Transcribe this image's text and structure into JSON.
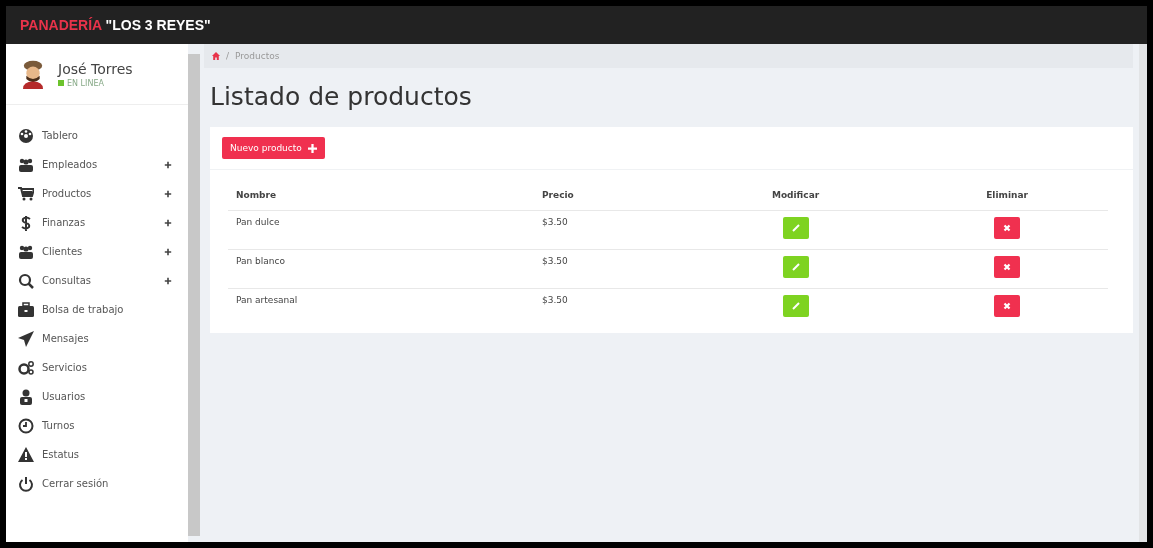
{
  "topbar": {
    "brand_main": "PANADERÍA",
    "brand_name": "\"LOS 3 REYES\""
  },
  "sidebar": {
    "user": {
      "name": "José Torres",
      "status": "EN LINEA",
      "online": true
    },
    "items": [
      {
        "label": "Tablero",
        "expandable": false
      },
      {
        "label": "Empleados",
        "expandable": true
      },
      {
        "label": "Productos",
        "expandable": true
      },
      {
        "label": "Finanzas",
        "expandable": true
      },
      {
        "label": "Clientes",
        "expandable": true
      },
      {
        "label": "Consultas",
        "expandable": true
      },
      {
        "label": "Bolsa de trabajo",
        "expandable": false
      },
      {
        "label": "Mensajes",
        "expandable": false
      },
      {
        "label": "Servicios",
        "expandable": false
      },
      {
        "label": "Usuarios",
        "expandable": false
      },
      {
        "label": "Turnos",
        "expandable": false
      },
      {
        "label": "Estatus",
        "expandable": false
      },
      {
        "label": "Cerrar sesión",
        "expandable": false
      }
    ]
  },
  "breadcrumb": {
    "separator": "/",
    "items": [
      "Productos"
    ]
  },
  "page_title": "Listado de productos",
  "new_button": "Nuevo producto",
  "table": {
    "columns": [
      "Nombre",
      "Precio",
      "Modificar",
      "Eliminar"
    ],
    "rows": [
      {
        "name": "Pan dulce",
        "price": "$3.50"
      },
      {
        "name": "Pan blanco",
        "price": "$3.50"
      },
      {
        "name": "Pan artesanal",
        "price": "$3.50"
      }
    ]
  }
}
